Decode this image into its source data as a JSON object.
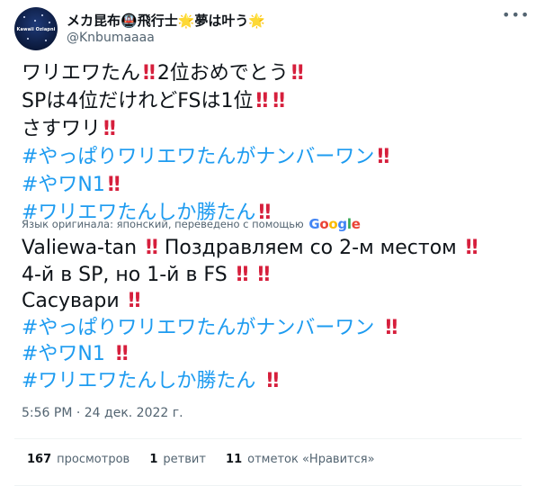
{
  "tweet": {
    "author": {
      "display_name": "メカ昆布",
      "display_name_emoji_1": "🚇",
      "display_name_part_2": "飛行士",
      "display_name_emoji_2": "🌟",
      "display_name_part_3": "夢は叶う",
      "display_name_emoji_3": "🌟",
      "handle": "@Knbumaaaa",
      "avatar_text": "Kawaii Oziapni",
      "more_glyph": "•••"
    },
    "original": {
      "line1_text": "ワリエワたん",
      "line1_after": "2位おめでとう",
      "line2_text_a": "SPは4位だけれどFSは1位",
      "line3_text": "さすワリ",
      "line4_hashtag": "#やっぱりワリエワたんがナンバーワン",
      "line5_hashtag": "#やワN1",
      "line6_hashtag": "#ワリエワたんしか勝たん",
      "excl": "‼"
    },
    "translation_note": "Язык оригинала: японский, переведено с помощью",
    "google_logo": {
      "g1": "G",
      "o1": "o",
      "o2": "o",
      "g2": "g",
      "l": "l",
      "e": "e"
    },
    "translated": {
      "line1_text": "Valiewa-tan",
      "line1_after": "Поздравляем со 2-м местом",
      "line2_text": "4-й в SP, но 1-й в FS",
      "line3_text": "Сасувари",
      "line4_hashtag": "#やっぱりワリエワたんがナンバーワン",
      "line5_hashtag": "#やワN1",
      "line6_hashtag": "#ワリエワたんしか勝たん"
    },
    "timestamp": "5:56 PM · 24 дек. 2022 г.",
    "stats": [
      {
        "count": "167",
        "label": "просмотров"
      },
      {
        "count": "1",
        "label": "ретвит"
      },
      {
        "count": "11",
        "label": "отметок «Нравится»"
      }
    ],
    "colors": {
      "hashtag": "#1d9bf0",
      "exclamation": "#d61f3c",
      "muted": "#536471"
    }
  }
}
